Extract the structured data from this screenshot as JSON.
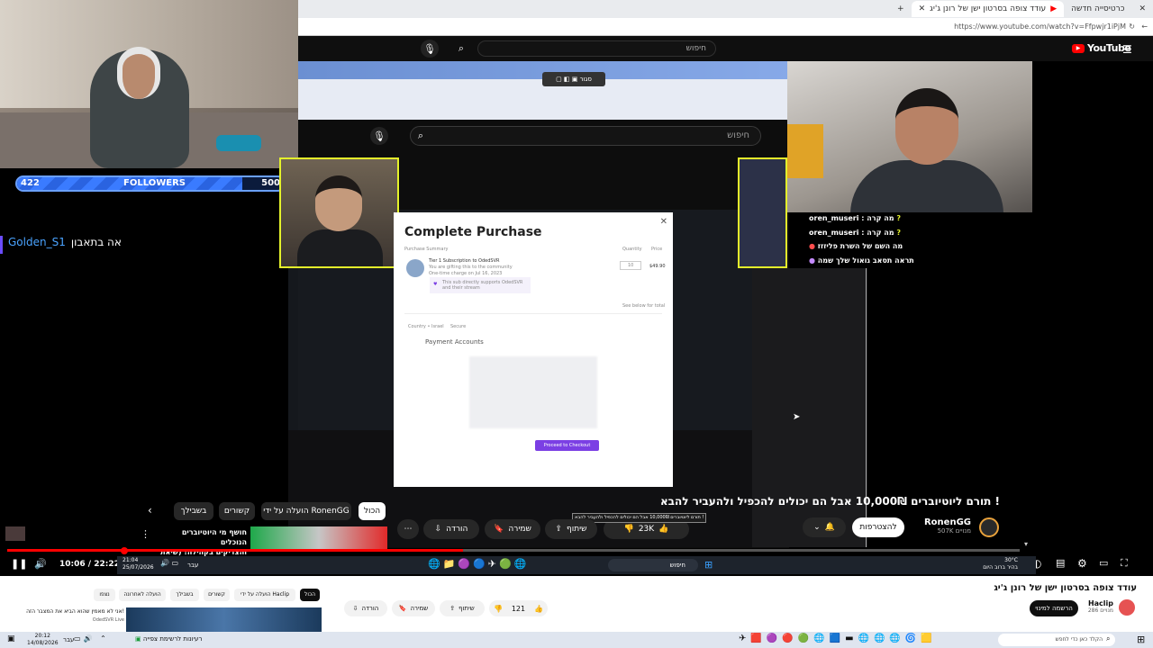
{
  "overlay": {
    "followers": {
      "current": "422",
      "label": "FOLLOWERS",
      "goal": "500",
      "progress_fraction": 0.844
    },
    "chat_left": {
      "user": "Golden_S1",
      "message": "אה בתאבון"
    }
  },
  "browser": {
    "tabs": [
      {
        "label": "עודד צופה בסרטון ישן של רונן ג'יג",
        "active": true
      },
      {
        "label": "כרטיסייה חדשה",
        "active": false
      }
    ],
    "url": "https://www.youtube.com/watch?v=Ffpwjr1iPjM"
  },
  "youtube": {
    "logo": "YouTube",
    "search_placeholder": "חיפוש",
    "inner_search_placeholder": "חיפוש",
    "video_title": "תורם ליוטיוברים 10,000₪ אבל הם יכולים להכפיל ולהעביר להבא !",
    "tooltip": "תורם ליוטיוברים 10,000₪ אבל הם יכולים להכפיל ולהעביר להבא !",
    "channel": {
      "name": "RonenGG",
      "subs": "507K מנויים",
      "join_label": "להצטרפות"
    },
    "likes": "23K",
    "share_label": "שיתוף",
    "save_label": "שמירה",
    "download_label": "הורדה",
    "filter_chips": [
      "הכול",
      "הועלה על ידי RonenGG",
      "קשורים",
      "בשבילך"
    ],
    "suggested": {
      "title_line1": "חושף מי היוטיוברים הנוכלים",
      "title_line2": "והצדיקים בקהילה! (שיאת ..."
    },
    "time_current": "10:06",
    "time_total": "22:22",
    "progress_fraction": 0.45
  },
  "modal": {
    "title": "Complete Purchase",
    "section": "Purchase Summary",
    "qty_label": "Quantity",
    "price_label": "Price",
    "tier_line": "Tier 1 Subscription to OdedSVR",
    "gift_line": "You are gifting this to the community",
    "charge_line": "One-time charge on Jul 16, 2023",
    "quantity": "10",
    "price": "$49.90",
    "support_line": "This sub directly supports OdedSVR and their stream",
    "breakdown": "See below for total",
    "country": "Country • Israel",
    "secure": "Secure",
    "payment_accounts": "Payment Accounts",
    "checkout_button": "Proceed to Checkout"
  },
  "stream_chat": [
    {
      "user": "oren_museri",
      "message": "מה קרה"
    },
    {
      "user": "oren_museri",
      "message": "מה קרה"
    },
    {
      "user": "",
      "message": "מה השם של השרת פליזזז"
    },
    {
      "user": "",
      "message": "תראה תסאב גואול שלך שמה"
    }
  ],
  "inner_taskbar": {
    "time": "21:04",
    "date": "25/07/2026",
    "search": "חיפוש",
    "weather": "30°C",
    "weather_desc": "בהיר ברוב היום",
    "lang": "עבר"
  },
  "page_lower": {
    "title": "עודד צופה בסרטון ישן של רונן ג'יג",
    "channel": "Haclip",
    "subs": "286 מנויים",
    "subscribe_label": "הרשמה למינוי",
    "likes": "121",
    "share_label": "שיתוף",
    "save_label": "שמירה",
    "download_label": "הורדה",
    "chips": [
      "הכול",
      "הועלה על ידי Haclip",
      "קשורים",
      "בשבילך",
      "הועלה לאחרונה",
      "נצפו"
    ],
    "suggested_title": "אני לא מאמין שהוא הביא את המצבר הזה!",
    "suggested_channel": "OdedSVR Live"
  },
  "taskbar": {
    "time": "20:12",
    "date": "14/08/2026",
    "lang": "עבר",
    "search": "הקלד כאן כדי לחפש",
    "notification": "רעיונות לרשימת צפייה"
  },
  "colors": {
    "accent_red": "#ff0000",
    "yt_dark": "#0f0f0f",
    "cam_frame": "#e4f22b",
    "followers_blue": "#3a7bff",
    "checkout_purple": "#7b3fe4"
  }
}
